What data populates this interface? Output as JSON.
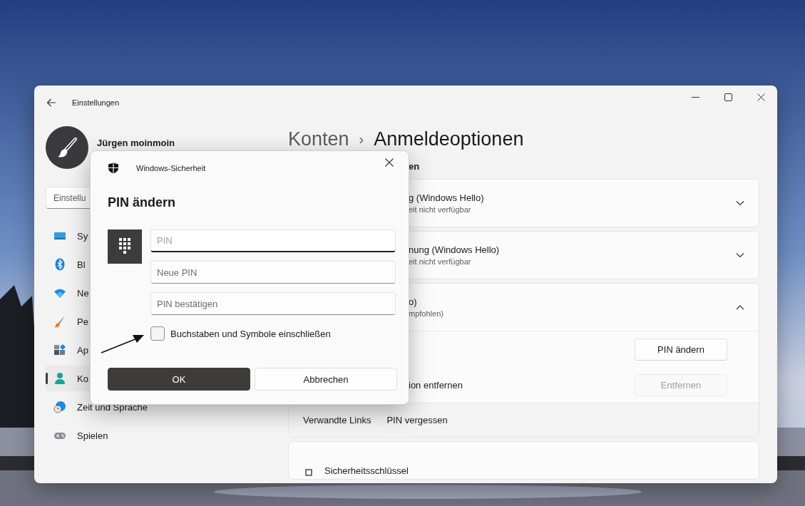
{
  "window": {
    "title": "Einstellungen",
    "user": {
      "name": "Jürgen moinmoin"
    },
    "search": {
      "value": "Einstellu"
    },
    "nav": [
      {
        "label": "Sy",
        "selected": false
      },
      {
        "label": "Bl",
        "selected": false
      },
      {
        "label": "Ne",
        "selected": false
      },
      {
        "label": "Pe",
        "selected": false
      },
      {
        "label": "Ap",
        "selected": false
      },
      {
        "label": "Ko",
        "selected": true
      },
      {
        "label": "Zeit und Sprache",
        "selected": false
      },
      {
        "label": "Spielen",
        "selected": false
      }
    ]
  },
  "breadcrumb": {
    "parent": "Konten",
    "separator": "›",
    "current": "Anmeldeoptionen"
  },
  "section_heading": "en",
  "cards": [
    {
      "title": "g (Windows Hello)",
      "subtitle": "eit nicht verfügbar",
      "expanded": false
    },
    {
      "title": "nung (Windows Hello)",
      "subtitle": "eit nicht verfügbar",
      "expanded": false
    },
    {
      "title": "o)",
      "subtitle": "mpfohlen)",
      "expanded": true,
      "rows": [
        {
          "button": "PIN ändern",
          "disabled": false
        },
        {
          "label": "ion entfernen",
          "button": "Entfernen",
          "disabled": true
        }
      ],
      "related": {
        "label": "Verwandte Links",
        "link": "PIN vergessen"
      }
    },
    {
      "title": "Sicherheitsschlüssel"
    }
  ],
  "dialog": {
    "app": "Windows-Sicherheit",
    "title": "PIN ändern",
    "fields": [
      {
        "placeholder": "PIN",
        "focused": true
      },
      {
        "placeholder": "Neue PIN",
        "focused": false
      },
      {
        "placeholder": "PIN bestätigen",
        "focused": false
      }
    ],
    "checkbox": {
      "label": "Buchstaben und Symbole einschließen",
      "checked": false
    },
    "buttons": [
      {
        "label": "OK",
        "kind": "primary"
      },
      {
        "label": "Abbrechen",
        "kind": "secondary"
      }
    ]
  }
}
